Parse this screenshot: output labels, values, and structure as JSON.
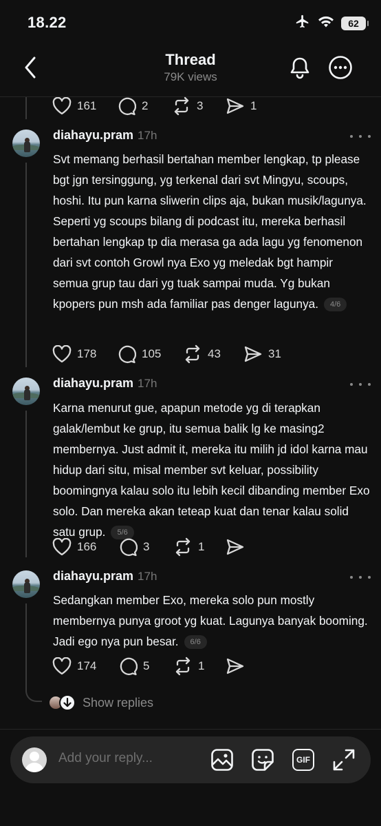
{
  "status_bar": {
    "time": "18.22",
    "battery": "62",
    "icons": [
      "airplane-icon",
      "wifi-icon",
      "battery-icon"
    ]
  },
  "nav": {
    "title": "Thread",
    "views": "79K views",
    "icons": [
      "back-icon",
      "bell-icon",
      "more-icon"
    ]
  },
  "prev_actions": {
    "likes": "161",
    "comments": "2",
    "reposts": "3",
    "shares": "1"
  },
  "posts": [
    {
      "username": "diahayu.pram",
      "time": "17h",
      "text": "Svt memang berhasil bertahan member lengkap, tp please bgt jgn tersinggung, yg terkenal dari svt Mingyu, scoups, hoshi. Itu pun karna sliwerin clips aja, bukan musik/lagunya. Seperti yg scoups bilang di podcast itu, mereka berhasil bertahan lengkap tp dia merasa ga ada lagu yg fenomenon dari svt contoh Growl nya Exo yg meledak bgt hampir semua grup tau dari yg tuak sampai muda. Yg bukan kpopers pun msh ada familiar pas denger lagunya.",
      "page": "4/6",
      "likes": "178",
      "comments": "105",
      "reposts": "43",
      "shares": "31"
    },
    {
      "username": "diahayu.pram",
      "time": "17h",
      "text": "Karna menurut gue, apapun metode yg di terapkan galak/lembut ke grup, itu semua balik lg ke masing2 membernya. Just admit it, mereka itu milih jd idol karna mau hidup dari situ, misal member svt keluar, possibility boomingnya kalau solo itu lebih kecil dibanding member Exo solo. Dan mereka akan teteap kuat dan tenar kalau solid satu grup.",
      "page": "5/6",
      "likes": "166",
      "comments": "3",
      "reposts": "1",
      "shares": ""
    },
    {
      "username": "diahayu.pram",
      "time": "17h",
      "text": "Sedangkan member Exo, mereka solo pun mostly membernya punya groot yg kuat. Lagunya banyak booming. Jadi ego nya pun besar.",
      "page": "6/6",
      "likes": "174",
      "comments": "5",
      "reposts": "1",
      "shares": ""
    }
  ],
  "show_replies": "Show replies",
  "composer": {
    "placeholder": "Add your reply...",
    "gif_label": "GIF",
    "icons": [
      "image-icon",
      "sticker-icon",
      "gif-icon",
      "expand-icon"
    ]
  },
  "colors": {
    "background": "#101010",
    "text": "#f3f5f7",
    "secondary": "#777777",
    "composer_bg": "#262626"
  }
}
